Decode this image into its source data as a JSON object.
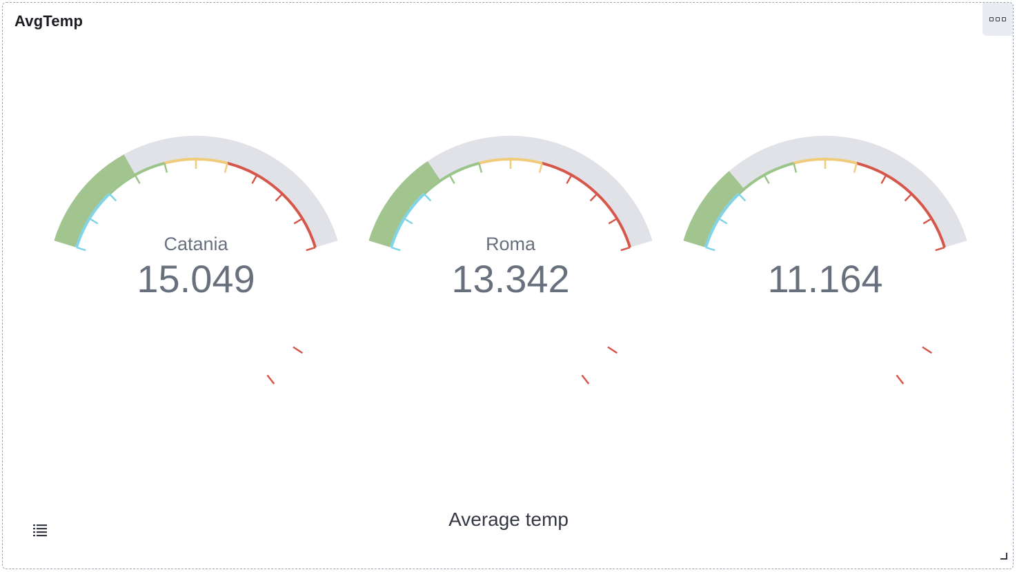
{
  "panel": {
    "title": "AvgTemp",
    "options_icon": "ellipsis-boxes-icon",
    "legend_icon": "list-icon",
    "resize_icon": "resize-corner-icon"
  },
  "footer": {
    "label": "Average temp"
  },
  "colors": {
    "fill": "#a2c58f",
    "track": "#e0e2e7",
    "band_blue": "#7fd4e8",
    "band_green": "#9bc48a",
    "band_yellow": "#efcb7b",
    "band_red": "#d4574a",
    "text": "#69707d"
  },
  "chart_data": {
    "type": "gauge",
    "range": [
      0,
      50
    ],
    "fill_start_value": 0,
    "color_bands": [
      {
        "from": 0,
        "to": 10,
        "color": "#7fd4e8"
      },
      {
        "from": 10,
        "to": 20,
        "color": "#9bc48a"
      },
      {
        "from": 20,
        "to": 30,
        "color": "#efcb7b"
      },
      {
        "from": 30,
        "to": 50,
        "color": "#d4574a"
      }
    ],
    "gauges": [
      {
        "label": "Catania",
        "value": 15.049
      },
      {
        "label": "Roma",
        "value": 13.342
      },
      {
        "label": "",
        "value": 11.164
      }
    ]
  }
}
